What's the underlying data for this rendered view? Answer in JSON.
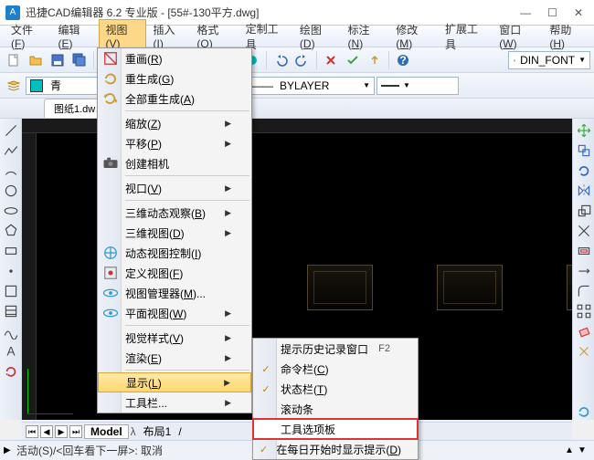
{
  "title": "迅捷CAD编辑器 6.2 专业版 - [55#-130平方.dwg]",
  "menubar": [
    "文件(F)",
    "编辑(E)",
    "视图(V)",
    "插入(I)",
    "格式(O)",
    "定制工具",
    "绘图(D)",
    "标注(N)",
    "修改(M)",
    "扩展工具",
    "窗口(W)",
    "帮助(H)"
  ],
  "menubar_active_index": 2,
  "filetab": "图纸1.dw…",
  "combo_color": "青",
  "combo_layer": "BYLAYER",
  "combo_font": "DIN_FONT",
  "view_menu": [
    {
      "label": "重画(R)",
      "icon": "redraw"
    },
    {
      "label": "重生成(G)",
      "icon": "regen"
    },
    {
      "label": "全部重生成(A)",
      "icon": "regen-all"
    },
    {
      "sep": true
    },
    {
      "label": "缩放(Z)",
      "sub": true
    },
    {
      "label": "平移(P)",
      "sub": true
    },
    {
      "label": "创建相机",
      "icon": "camera"
    },
    {
      "sep": true
    },
    {
      "label": "视口(V)",
      "sub": true
    },
    {
      "sep": true
    },
    {
      "label": "三维动态观察(B)",
      "sub": true
    },
    {
      "label": "三维视图(D)",
      "sub": true
    },
    {
      "label": "动态视图控制(I)",
      "icon": "dyn-view"
    },
    {
      "label": "定义视图(F)",
      "icon": "def-view"
    },
    {
      "label": "视图管理器(M)...",
      "icon": "view-mgr"
    },
    {
      "label": "平面视图(W)",
      "icon": "plan-view",
      "sub": true
    },
    {
      "sep": true
    },
    {
      "label": "视觉样式(V)",
      "sub": true
    },
    {
      "label": "渲染(E)",
      "sub": true
    },
    {
      "sep": true
    },
    {
      "label": "显示(L)",
      "sub": true,
      "highlight": true
    },
    {
      "label": "工具栏...",
      "sub": true
    }
  ],
  "display_submenu": [
    {
      "label": "提示历史记录窗口",
      "shortcut": "F2"
    },
    {
      "label": "命令栏(C)",
      "check": true
    },
    {
      "label": "状态栏(T)",
      "check": true
    },
    {
      "label": "滚动条"
    },
    {
      "label": "工具选项板",
      "highlight_red": true
    },
    {
      "label": "在每日开始时显示提示(D)",
      "check": true
    }
  ],
  "model_tabs": {
    "active": "Model",
    "other": "布局1"
  },
  "command_line": "活动(S)/<回车看下一屏>: 取消",
  "colors": {
    "accent": "#1e80c8",
    "highlight": "#ffd86f",
    "red": "#d33"
  }
}
